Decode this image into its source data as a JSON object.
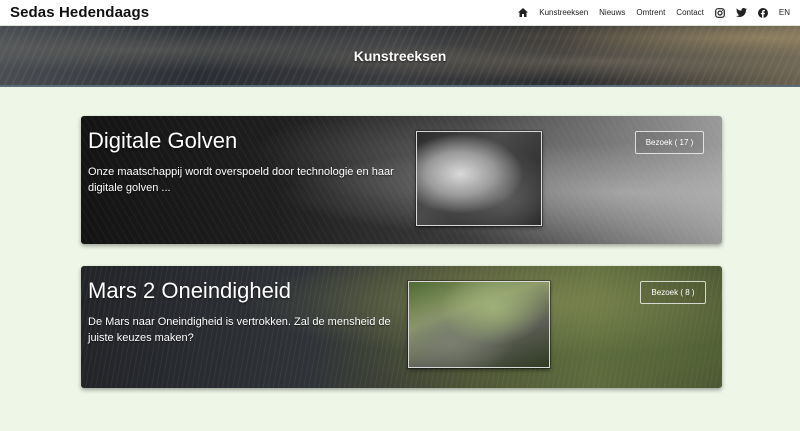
{
  "navbar": {
    "brand": "Sedas Hedendaags",
    "links": {
      "series": "Kunstreeksen",
      "news": "Nieuws",
      "about": "Omtrent",
      "contact": "Contact",
      "lang": "EN"
    },
    "icons": [
      "home-icon",
      "instagram-icon",
      "twitter-icon",
      "facebook-icon"
    ]
  },
  "hero": {
    "title": "Kunstreeksen"
  },
  "cards": [
    {
      "title": "Digitale Golven",
      "description": "Onze maatschappij wordt overspoeld door technologie en haar digitale golven ...",
      "button": "Bezoek ( 17 )"
    },
    {
      "title": "Mars 2 Oneindigheid",
      "description": "De Mars naar Oneindigheid is vertrokken. Zal de mensheid de juiste keuzes maken?",
      "button": "Bezoek ( 8 )"
    }
  ]
}
